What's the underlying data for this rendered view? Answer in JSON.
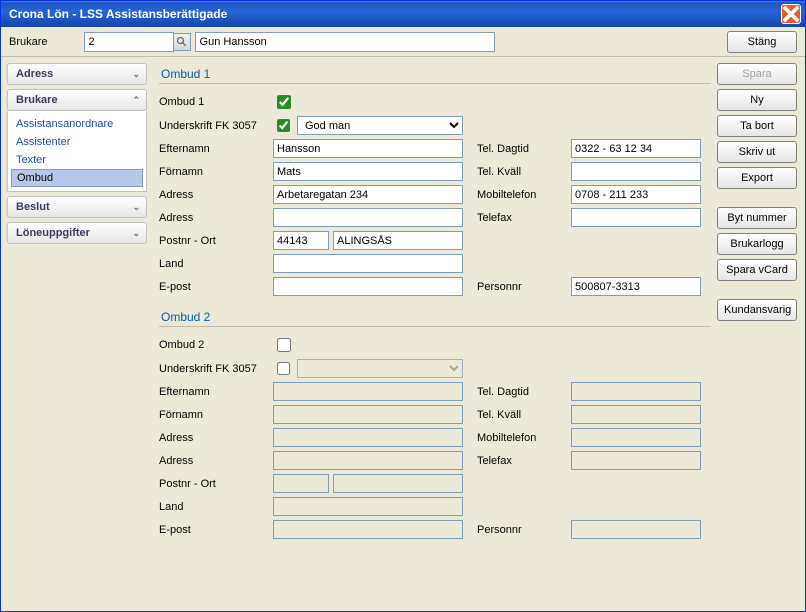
{
  "window": {
    "title": "Crona Lön - LSS Assistansberättigade"
  },
  "toolbar": {
    "brukare_label": "Brukare",
    "brukare_id": "2",
    "brukare_name": "Gun Hansson",
    "close_label": "Stäng"
  },
  "sidebar": {
    "adress_label": "Adress",
    "brukare_label": "Brukare",
    "brukare_items": {
      "assistansanordnare": "Assistansanordnare",
      "assistenter": "Assistenter",
      "texter": "Texter",
      "ombud": "Ombud"
    },
    "beslut_label": "Beslut",
    "loneuppgifter_label": "Löneuppgifter"
  },
  "buttons": {
    "spara": "Spara",
    "ny": "Ny",
    "ta_bort": "Ta bort",
    "skriv_ut": "Skriv ut",
    "export": "Export",
    "byt_nummer": "Byt nummer",
    "brukarlogg": "Brukarlogg",
    "spara_vcard": "Spara vCard",
    "kundansvarig": "Kundansvarig"
  },
  "labels": {
    "ombud1_title": "Ombud 1",
    "ombud2_title": "Ombud 2",
    "ombud1": "Ombud 1",
    "ombud2": "Ombud 2",
    "underskrift": "Underskrift FK 3057",
    "efternamn": "Efternamn",
    "fornamn": "Förnamn",
    "adress": "Adress",
    "postnr_ort": "Postnr - Ort",
    "land": "Land",
    "epost": "E-post",
    "tel_dagtid": "Tel. Dagtid",
    "tel_kvall": "Tel. Kväll",
    "mobil": "Mobiltelefon",
    "telefax": "Telefax",
    "personnr": "Personnr"
  },
  "ombud1": {
    "checked": true,
    "underskrift_checked": true,
    "underskrift_value": "God man",
    "efternamn": "Hansson",
    "fornamn": "Mats",
    "adress1": "Arbetaregatan 234",
    "adress2": "",
    "postnr": "44143",
    "ort": "ALINGSÅS",
    "land": "",
    "epost": "",
    "tel_dagtid": "0322 - 63 12 34",
    "tel_kvall": "",
    "mobil": "0708 - 211 233",
    "telefax": "",
    "personnr": "500807-3313"
  },
  "ombud2": {
    "checked": false,
    "underskrift_checked": false,
    "underskrift_value": "",
    "efternamn": "",
    "fornamn": "",
    "adress1": "",
    "adress2": "",
    "postnr": "",
    "ort": "",
    "land": "",
    "epost": "",
    "tel_dagtid": "",
    "tel_kvall": "",
    "mobil": "",
    "telefax": "",
    "personnr": ""
  }
}
